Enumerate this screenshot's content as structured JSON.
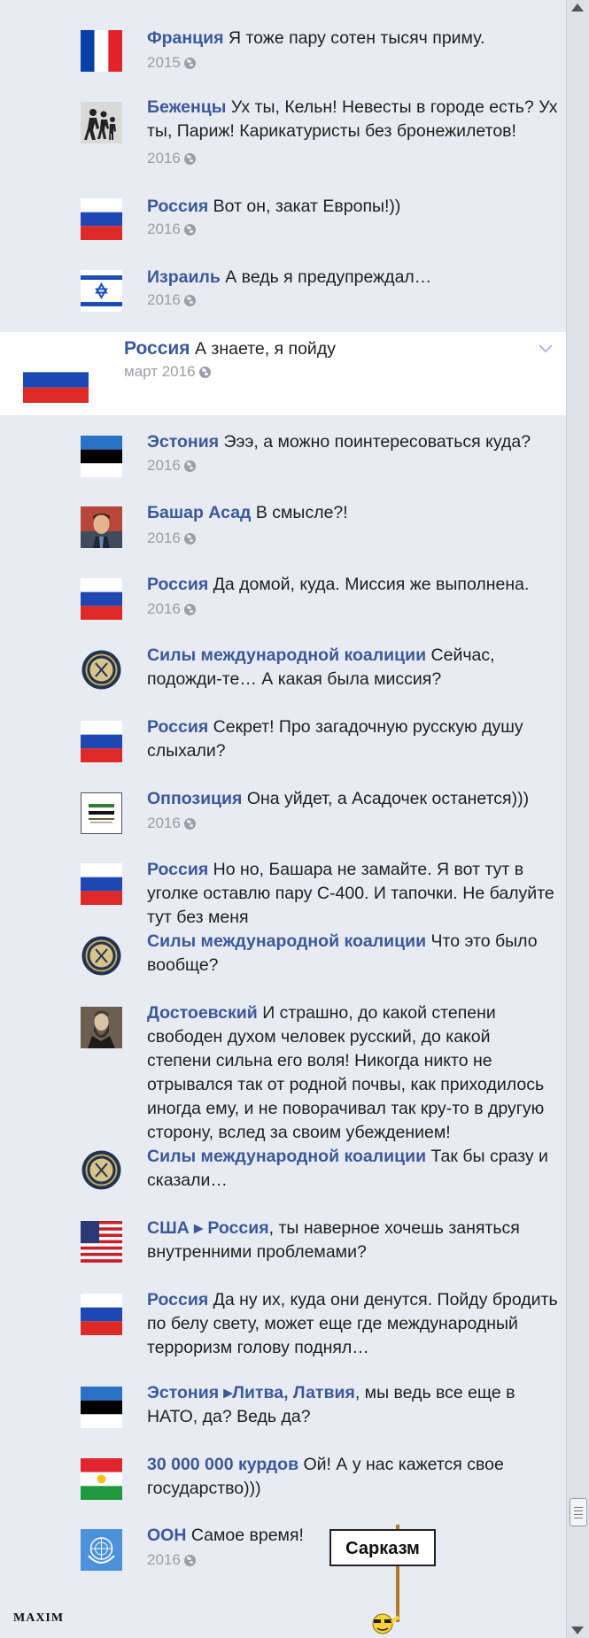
{
  "comments": [
    {
      "author": "Франция",
      "text": "Я тоже пару сотен тысяч приму.",
      "date": "2015",
      "avatar": "flag-france-icon"
    },
    {
      "author": "Беженцы",
      "text": "Ух ты, Кельн! Невесты в городе есть? Ух ты, Париж! Карикатуристы без бронежилетов!",
      "date": "2016",
      "avatar": "refugees-sign-icon"
    },
    {
      "author": "Россия",
      "text": "Вот он, закат Европы!))",
      "date": "2016",
      "avatar": "flag-russia-icon"
    },
    {
      "author": "Израиль",
      "text": "А ведь я предупреждал…",
      "date": "2016",
      "avatar": "flag-israel-icon"
    },
    {
      "author": "Россия",
      "text": "А знаете, я пойду",
      "date": "март 2016",
      "avatar": "flag-russia-icon",
      "highlighted": true
    },
    {
      "author": "Эстония",
      "text": "Эээ, а можно поинтересоваться куда?",
      "date": "2016",
      "avatar": "flag-estonia-icon"
    },
    {
      "author": "Башар Асад",
      "text": " В смысле?!",
      "date": "2016",
      "avatar": "assad-portrait-icon"
    },
    {
      "author": "Россия",
      "text": "Да домой, куда. Миссия же выполнена.",
      "date": "2016",
      "avatar": "flag-russia-icon"
    },
    {
      "author": "Силы международной коалиции",
      "text": "Сейчас, подожди-те… А какая была миссия?",
      "date": "",
      "avatar": "coalition-seal-icon"
    },
    {
      "author": "Россия",
      "text": "Секрет! Про загадочную русскую душу слыхали?",
      "date": "",
      "avatar": "flag-russia-icon"
    },
    {
      "author": "Оппозиция",
      "text": "Она уйдет, а Асадочек останется)))",
      "date": "2016",
      "avatar": "opposition-logo-icon"
    },
    {
      "author": "Россия",
      "text": " Но но, Башара не замайте. Я вот тут в уголке оставлю пару С-400. И тапочки. Не балуйте тут без меня",
      "date": "",
      "avatar": "flag-russia-icon"
    },
    {
      "author": "Силы международной коалиции",
      "text": "Что это было вообще?",
      "date": "",
      "avatar": "coalition-seal-icon"
    },
    {
      "author": "Достоевский",
      "text": "И страшно, до какой степени свободен духом человек русский, до какой степени сильна его воля! Никогда никто не отрывался так от родной почвы, как приходилось иногда ему, и не поворачивал так кру-то в другую сторону, вслед за своим убеждением!",
      "date": "",
      "avatar": "dostoevsky-portrait-icon"
    },
    {
      "author": "Силы международной коалиции",
      "text": " Так бы сразу и сказали…",
      "date": "",
      "avatar": "coalition-seal-icon"
    },
    {
      "author": "США ▸ Россия",
      "text": ", ты наверное хочешь заняться внутренними проблемами?",
      "date": "",
      "avatar": "flag-usa-icon"
    },
    {
      "author": "Россия",
      "text": "Да ну их, куда они денутся. Пойду бродить по белу свету, может еще где международный терроризм голову поднял…",
      "date": "",
      "avatar": "flag-russia-icon"
    },
    {
      "author": "Эстония ▸Литва, Латвия",
      "text": ", мы ведь все еще в НАТО, да? Ведь да?",
      "date": "",
      "avatar": "flag-estonia-icon"
    },
    {
      "author": "30 000 000 курдов",
      "text": "Ой! А у нас кажется свое государство)))",
      "date": "",
      "avatar": "flag-kurdistan-icon"
    },
    {
      "author": "ООН",
      "text": "Самое время!",
      "date": "2016",
      "avatar": "un-emblem-icon"
    }
  ],
  "sarcasm_sign": "Сарказм",
  "watermark": "MAXIM",
  "colors": {
    "author": "#3b5998",
    "background": "#e9ebf3",
    "highlight": "#ffffff",
    "meta": "#9b9ea6"
  }
}
